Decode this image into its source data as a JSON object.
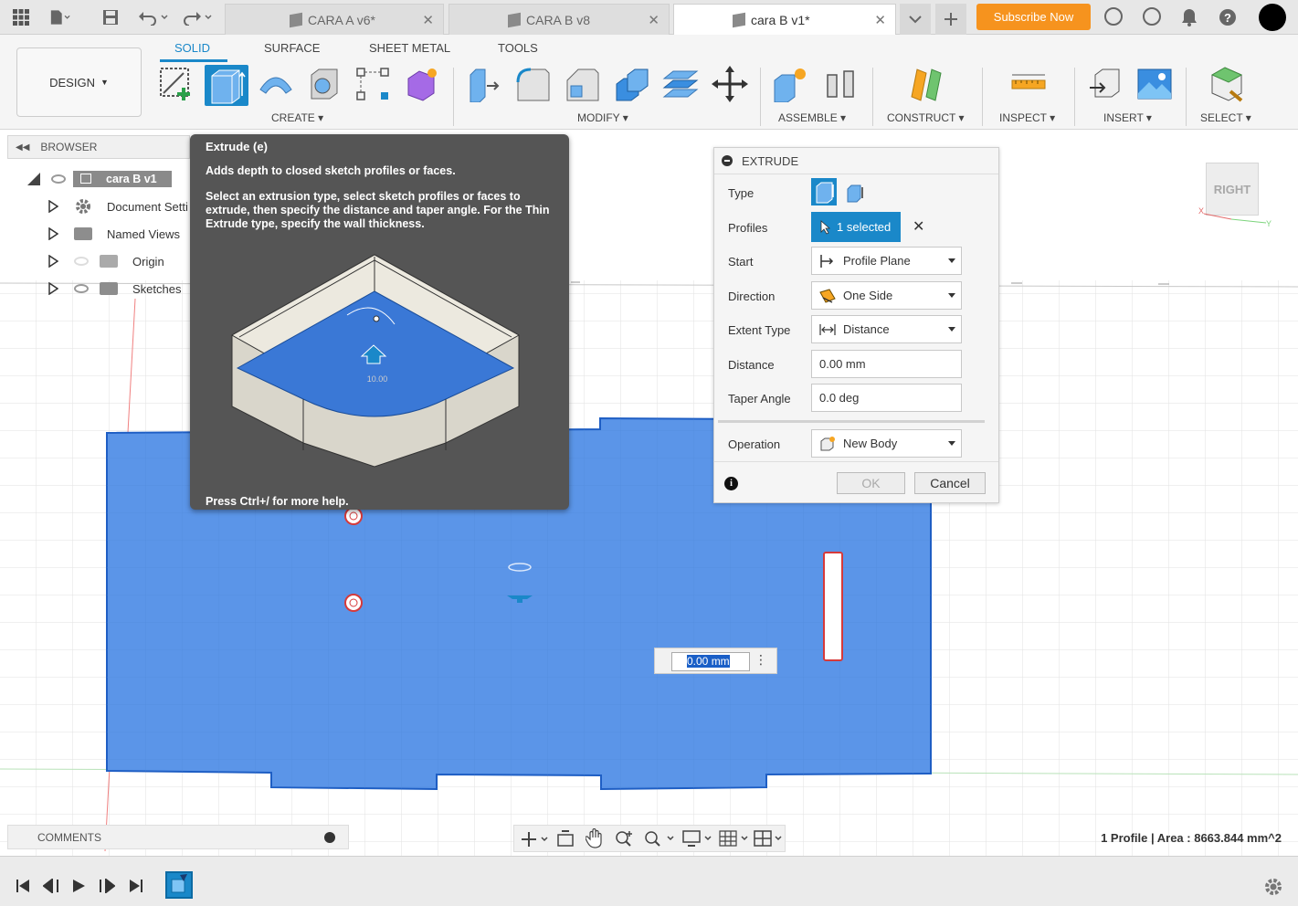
{
  "tabs": [
    {
      "label": "CARA A v6*",
      "active": false
    },
    {
      "label": "CARA B v8",
      "active": false
    },
    {
      "label": "cara B v1*",
      "active": true
    }
  ],
  "subscribe_label": "Subscribe Now",
  "workspace_label": "DESIGN",
  "ribbon_tabs": [
    "SOLID",
    "SURFACE",
    "SHEET METAL",
    "TOOLS"
  ],
  "ribbon_groups": [
    "CREATE",
    "MODIFY",
    "ASSEMBLE",
    "CONSTRUCT",
    "INSPECT",
    "INSERT",
    "SELECT"
  ],
  "browser": {
    "header": "BROWSER",
    "root": "cara B v1",
    "items": [
      "Document Setti",
      "Named Views",
      "Origin",
      "Sketches"
    ]
  },
  "tooltip": {
    "title": "Extrude (e)",
    "short": "Adds depth to closed sketch profiles or faces.",
    "long": "Select an extrusion type, select sketch profiles or faces to extrude, then specify the distance and taper angle. For the Thin Extrude type, specify the wall thickness.",
    "illustration_value": "10.00",
    "footer": "Press Ctrl+/ for more help."
  },
  "extrude": {
    "title": "EXTRUDE",
    "type_label": "Type",
    "profiles_label": "Profiles",
    "profiles_value": "1 selected",
    "start_label": "Start",
    "start_value": "Profile Plane",
    "direction_label": "Direction",
    "direction_value": "One Side",
    "extent_label": "Extent Type",
    "extent_value": "Distance",
    "distance_label": "Distance",
    "distance_value": "0.00 mm",
    "taper_label": "Taper Angle",
    "taper_value": "0.0 deg",
    "operation_label": "Operation",
    "operation_value": "New Body",
    "ok_label": "OK",
    "cancel_label": "Cancel"
  },
  "viewcube_label": "RIGHT",
  "inline_distance": "0.00 mm",
  "comments_label": "COMMENTS",
  "status_text": "1 Profile | Area : 8663.844 mm^2",
  "colors": {
    "accent": "#1a88c9",
    "profile_fill": "#5b95e8",
    "subscribe": "#f6931e",
    "tooltip_bg": "#555555"
  }
}
